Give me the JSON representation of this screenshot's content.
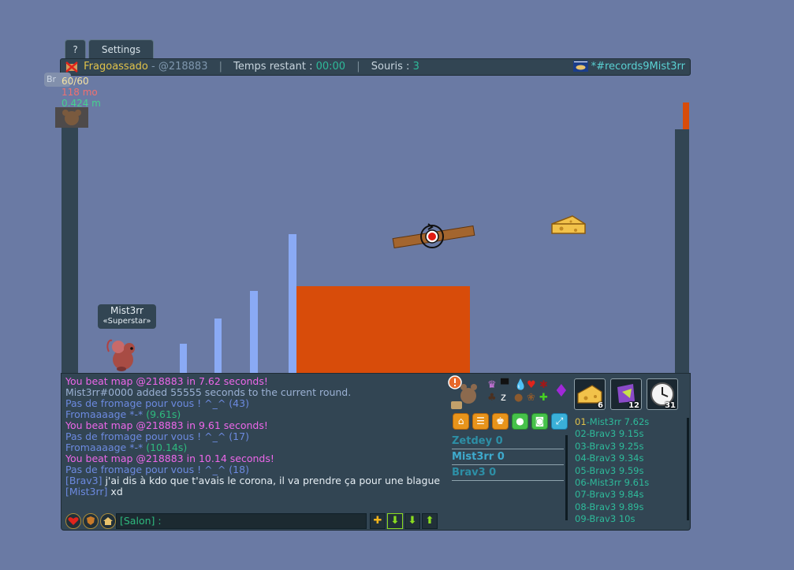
{
  "tabs": [
    {
      "label": "?"
    },
    {
      "label": "Settings"
    }
  ],
  "topbar": {
    "player_name": "Fragoassado",
    "map_code_prefix": "- ",
    "map_code": "@218883",
    "time_label": "Temps restant : ",
    "time_value": "00:00",
    "mice_label": "Souris : ",
    "mice_value": "3",
    "room_name": "*#records9Mist3rr"
  },
  "stats": {
    "badge": "Br",
    "health": "60/60",
    "money": "118 mo",
    "distance": "0.424 m"
  },
  "map": {
    "player": {
      "name": "Mist3rr",
      "title": "«Superstar»"
    },
    "colors": {
      "ground": "#d84c0a",
      "pillar": "#8aaaf5"
    }
  },
  "chat": {
    "lines": [
      {
        "segments": [
          {
            "text": "You beat map @218883 in 7.62 seconds!",
            "color": "pink"
          }
        ]
      },
      {
        "segments": [
          {
            "text": "Mist3rr#0000 added 55555 seconds to the current round.",
            "color": "lblue"
          }
        ]
      },
      {
        "segments": [
          {
            "text": "Pas de fromage pour vous ! ^_^ (43)",
            "color": "blue"
          }
        ]
      },
      {
        "segments": [
          {
            "text": "Fromaaaage *-* ",
            "color": "blue"
          },
          {
            "text": "(9.61s)",
            "color": "teal"
          }
        ]
      },
      {
        "segments": [
          {
            "text": "You beat map @218883 in 9.61 seconds!",
            "color": "pink"
          }
        ]
      },
      {
        "segments": [
          {
            "text": "Pas de fromage pour vous ! ^_^ (17)",
            "color": "blue"
          }
        ]
      },
      {
        "segments": [
          {
            "text": "Fromaaaage *-* ",
            "color": "blue"
          },
          {
            "text": "(10.14s)",
            "color": "teal"
          }
        ]
      },
      {
        "segments": [
          {
            "text": "You beat map @218883 in 10.14 seconds!",
            "color": "pink"
          }
        ]
      },
      {
        "segments": [
          {
            "text": "Pas de fromage pour vous ! ^_^ (18)",
            "color": "blue"
          }
        ]
      },
      {
        "segments": [
          {
            "text": "[Brav3] ",
            "color": "blue"
          },
          {
            "text": "j'ai dis à kdo que t'avais le corona, il va prendre ça pour une blague",
            "color": "white"
          }
        ]
      },
      {
        "segments": [
          {
            "text": "[Mist3rr] ",
            "color": "blue"
          },
          {
            "text": "xd",
            "color": "white"
          }
        ]
      }
    ],
    "input_prefix": "[Salon] :",
    "input_placeholder": ""
  },
  "players": [
    {
      "name": "Zetdey",
      "score": "0",
      "color": "#2d8fa6"
    },
    {
      "name": "Mist3rr",
      "score": "0",
      "color": "#3eaacd"
    },
    {
      "name": "Brav3",
      "score": "0",
      "color": "#2d8fa6"
    }
  ],
  "items": [
    {
      "icon": "cheese-icon",
      "count": "6"
    },
    {
      "icon": "magic-wing-icon",
      "count": "12"
    },
    {
      "icon": "clock-icon",
      "count": "31"
    }
  ],
  "ranking": [
    {
      "rank": "01",
      "name": "Mist3rr",
      "time": "7.62s"
    },
    {
      "rank": "02",
      "name": "Brav3",
      "time": "9.15s"
    },
    {
      "rank": "03",
      "name": "Brav3",
      "time": "9.25s"
    },
    {
      "rank": "04",
      "name": "Brav3",
      "time": "9.34s"
    },
    {
      "rank": "05",
      "name": "Brav3",
      "time": "9.59s"
    },
    {
      "rank": "06",
      "name": "Mist3rr",
      "time": "9.61s"
    },
    {
      "rank": "07",
      "name": "Brav3",
      "time": "9.84s"
    },
    {
      "rank": "08",
      "name": "Brav3",
      "time": "9.89s"
    },
    {
      "rank": "09",
      "name": "Brav3",
      "time": "10s"
    }
  ]
}
